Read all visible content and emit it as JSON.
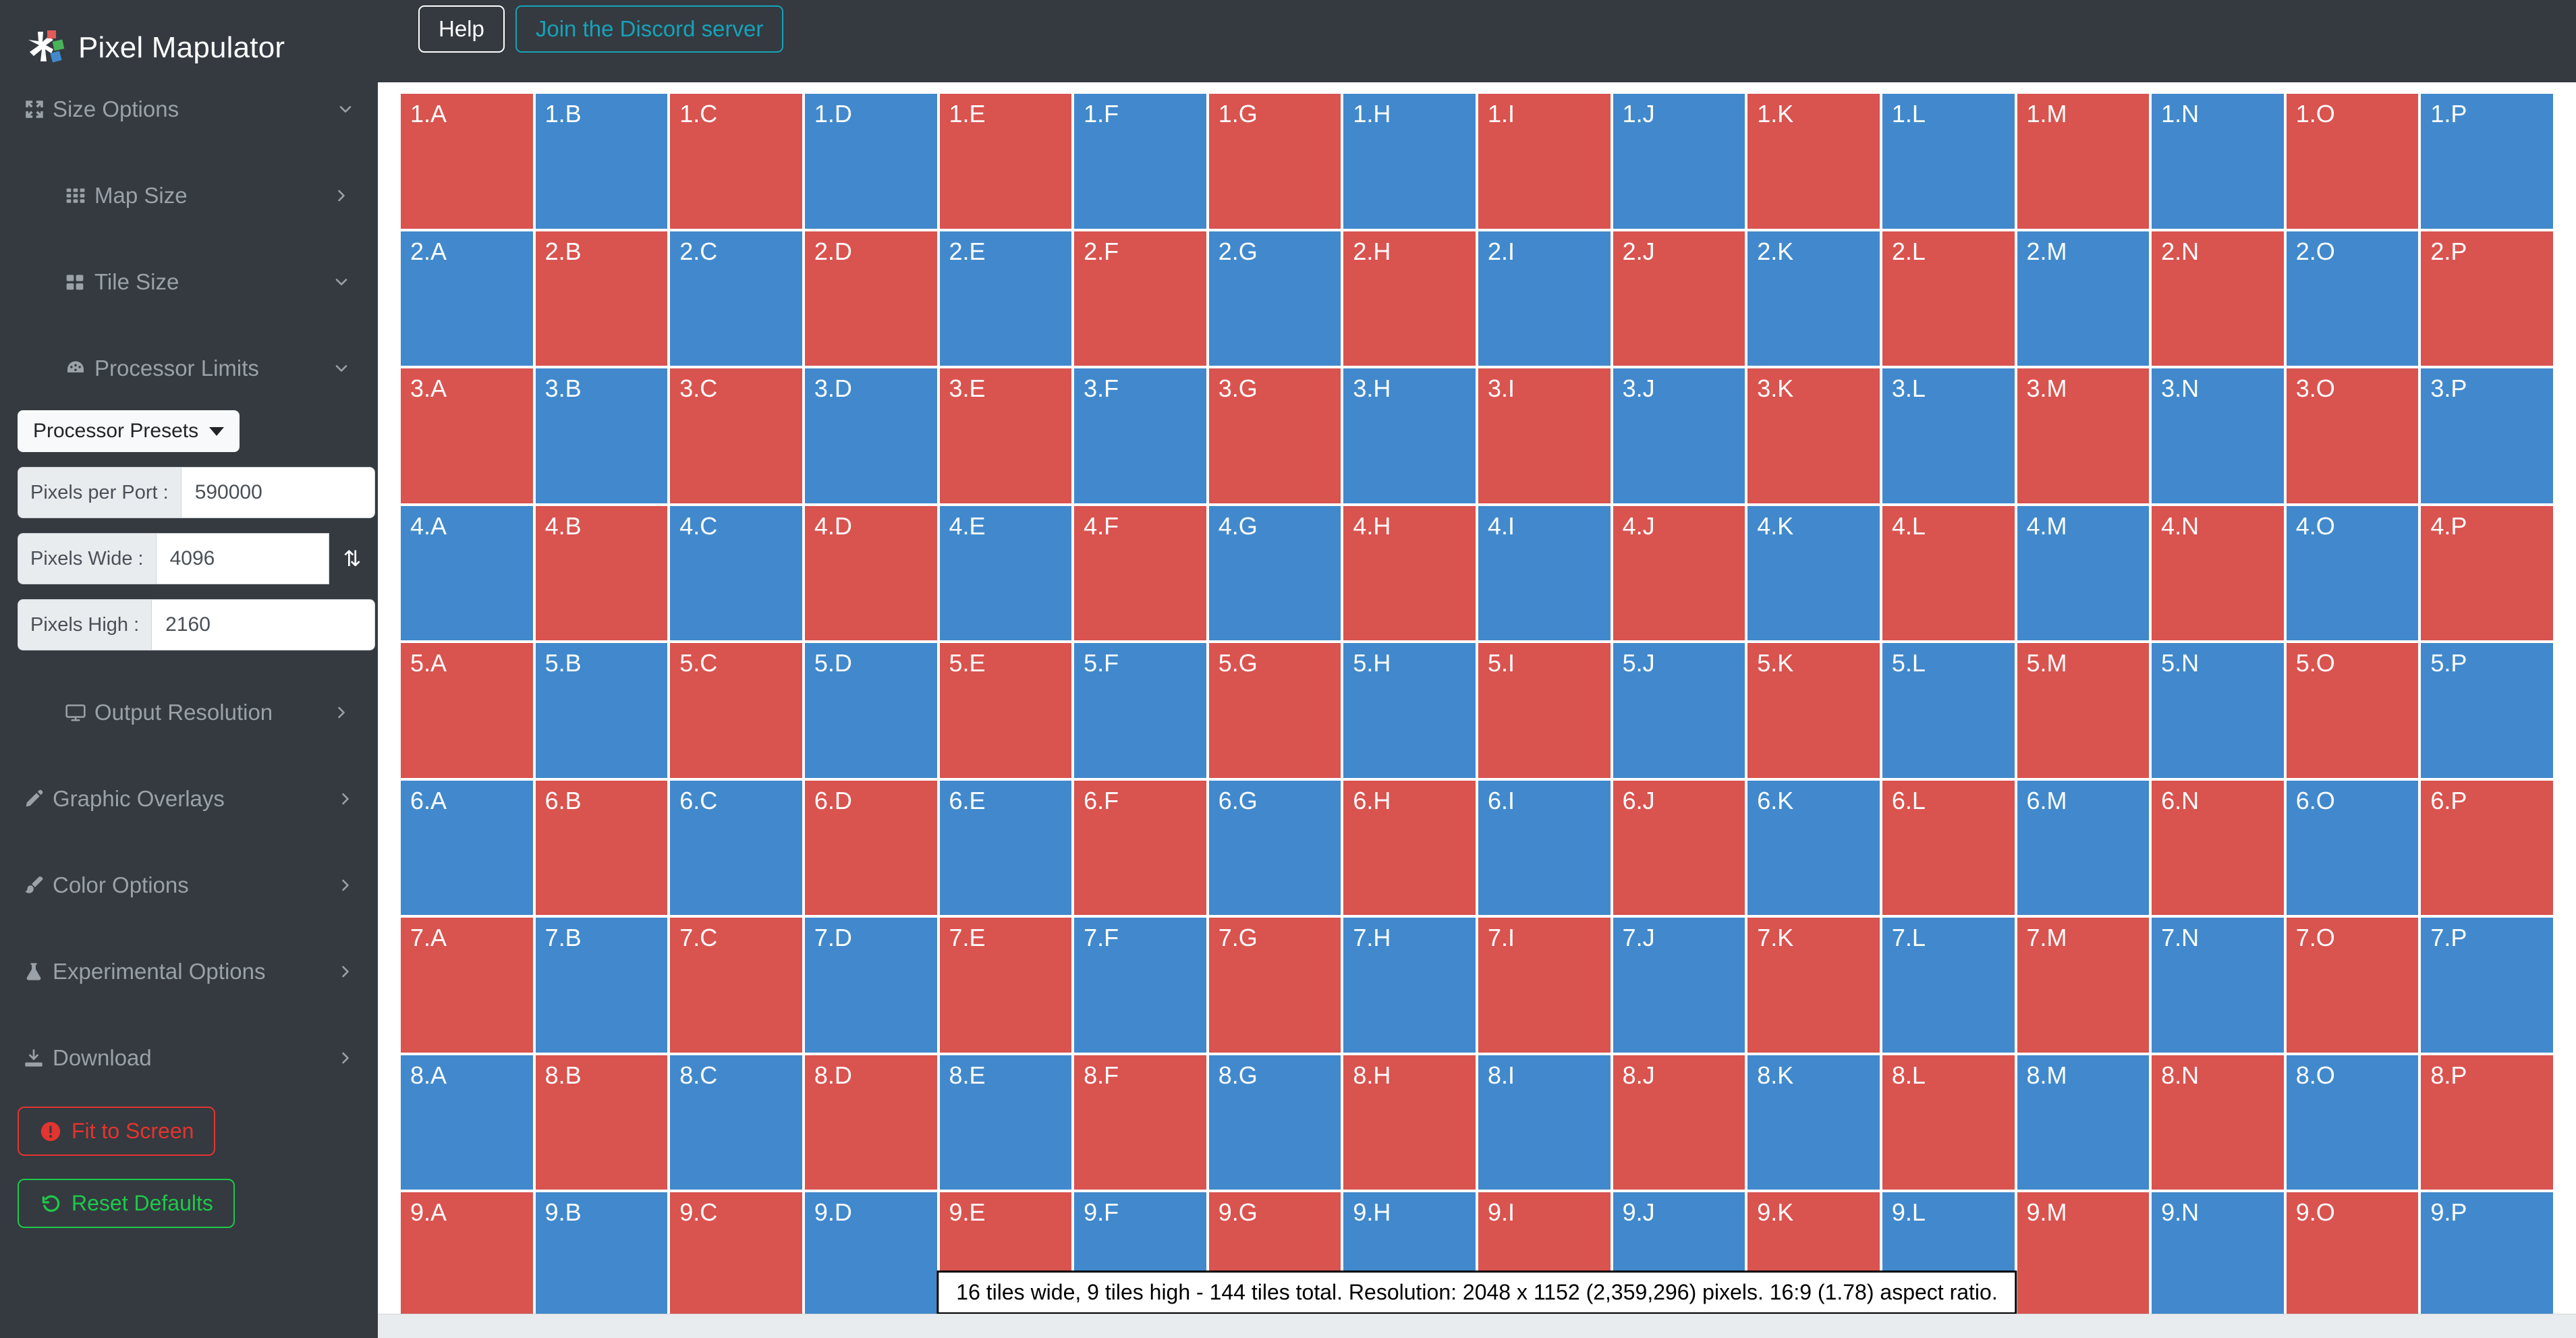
{
  "app": {
    "title": "Pixel Mapulator",
    "logo_icon": "pixel-splash-logo"
  },
  "toolbar": {
    "help_label": "Help",
    "discord_label": "Join the Discord server"
  },
  "sidebar": {
    "nav": [
      {
        "label": "Size Options",
        "icon": "arrows-expand-icon",
        "chevron": "chevron-down",
        "level": 0
      },
      {
        "label": "Map Size",
        "icon": "grid-icon",
        "chevron": "chevron-right",
        "level": 1
      },
      {
        "label": "Tile Size",
        "icon": "tiles-icon",
        "chevron": "chevron-down",
        "level": 1
      },
      {
        "label": "Processor Limits",
        "icon": "gauge-icon",
        "chevron": "chevron-down",
        "level": 1
      }
    ],
    "nav_lower": [
      {
        "label": "Output Resolution",
        "icon": "monitor-icon",
        "chevron": "chevron-right",
        "level": 1
      },
      {
        "label": "Graphic Overlays",
        "icon": "pencil-icon",
        "chevron": "chevron-right",
        "level": 0
      },
      {
        "label": "Color Options",
        "icon": "paintbrush-icon",
        "chevron": "chevron-right",
        "level": 0
      },
      {
        "label": "Experimental Options",
        "icon": "flask-icon",
        "chevron": "chevron-right",
        "level": 0
      },
      {
        "label": "Download",
        "icon": "download-icon",
        "chevron": "chevron-right",
        "level": 0
      }
    ],
    "presets": {
      "button_label": "Processor Presets",
      "caret_icon": "caret-down-icon"
    },
    "fields": [
      {
        "label": "Pixels per Port :",
        "value": "590000",
        "has_swap": false
      },
      {
        "label": "Pixels Wide :",
        "value": "4096",
        "has_swap": true,
        "swap_icon": "swap-vertical-icon",
        "swap_glyph": "⇅"
      },
      {
        "label": "Pixels High :",
        "value": "2160",
        "has_swap": false
      }
    ],
    "actions": [
      {
        "label": "Fit to Screen",
        "icon": "exclamation-circle-icon",
        "glyph": "❗",
        "style": "danger",
        "color": "#e3342f"
      },
      {
        "label": "Reset Defaults",
        "icon": "undo-icon",
        "glyph": "↺",
        "style": "success",
        "color": "#1ec94a"
      }
    ]
  },
  "grid": {
    "columns": [
      "A",
      "B",
      "C",
      "D",
      "E",
      "F",
      "G",
      "H",
      "I",
      "J",
      "K",
      "L",
      "M",
      "N",
      "O",
      "P"
    ],
    "rows": [
      1,
      2,
      3,
      4,
      5,
      6,
      7,
      8,
      9
    ],
    "color_red": "#d9534f",
    "color_blue": "#4189cc"
  },
  "status": {
    "text": "16 tiles wide, 9 tiles high - 144 tiles total. Resolution: 2048 x 1152 (2,359,296) pixels. 16:9 (1.78) aspect ratio."
  }
}
